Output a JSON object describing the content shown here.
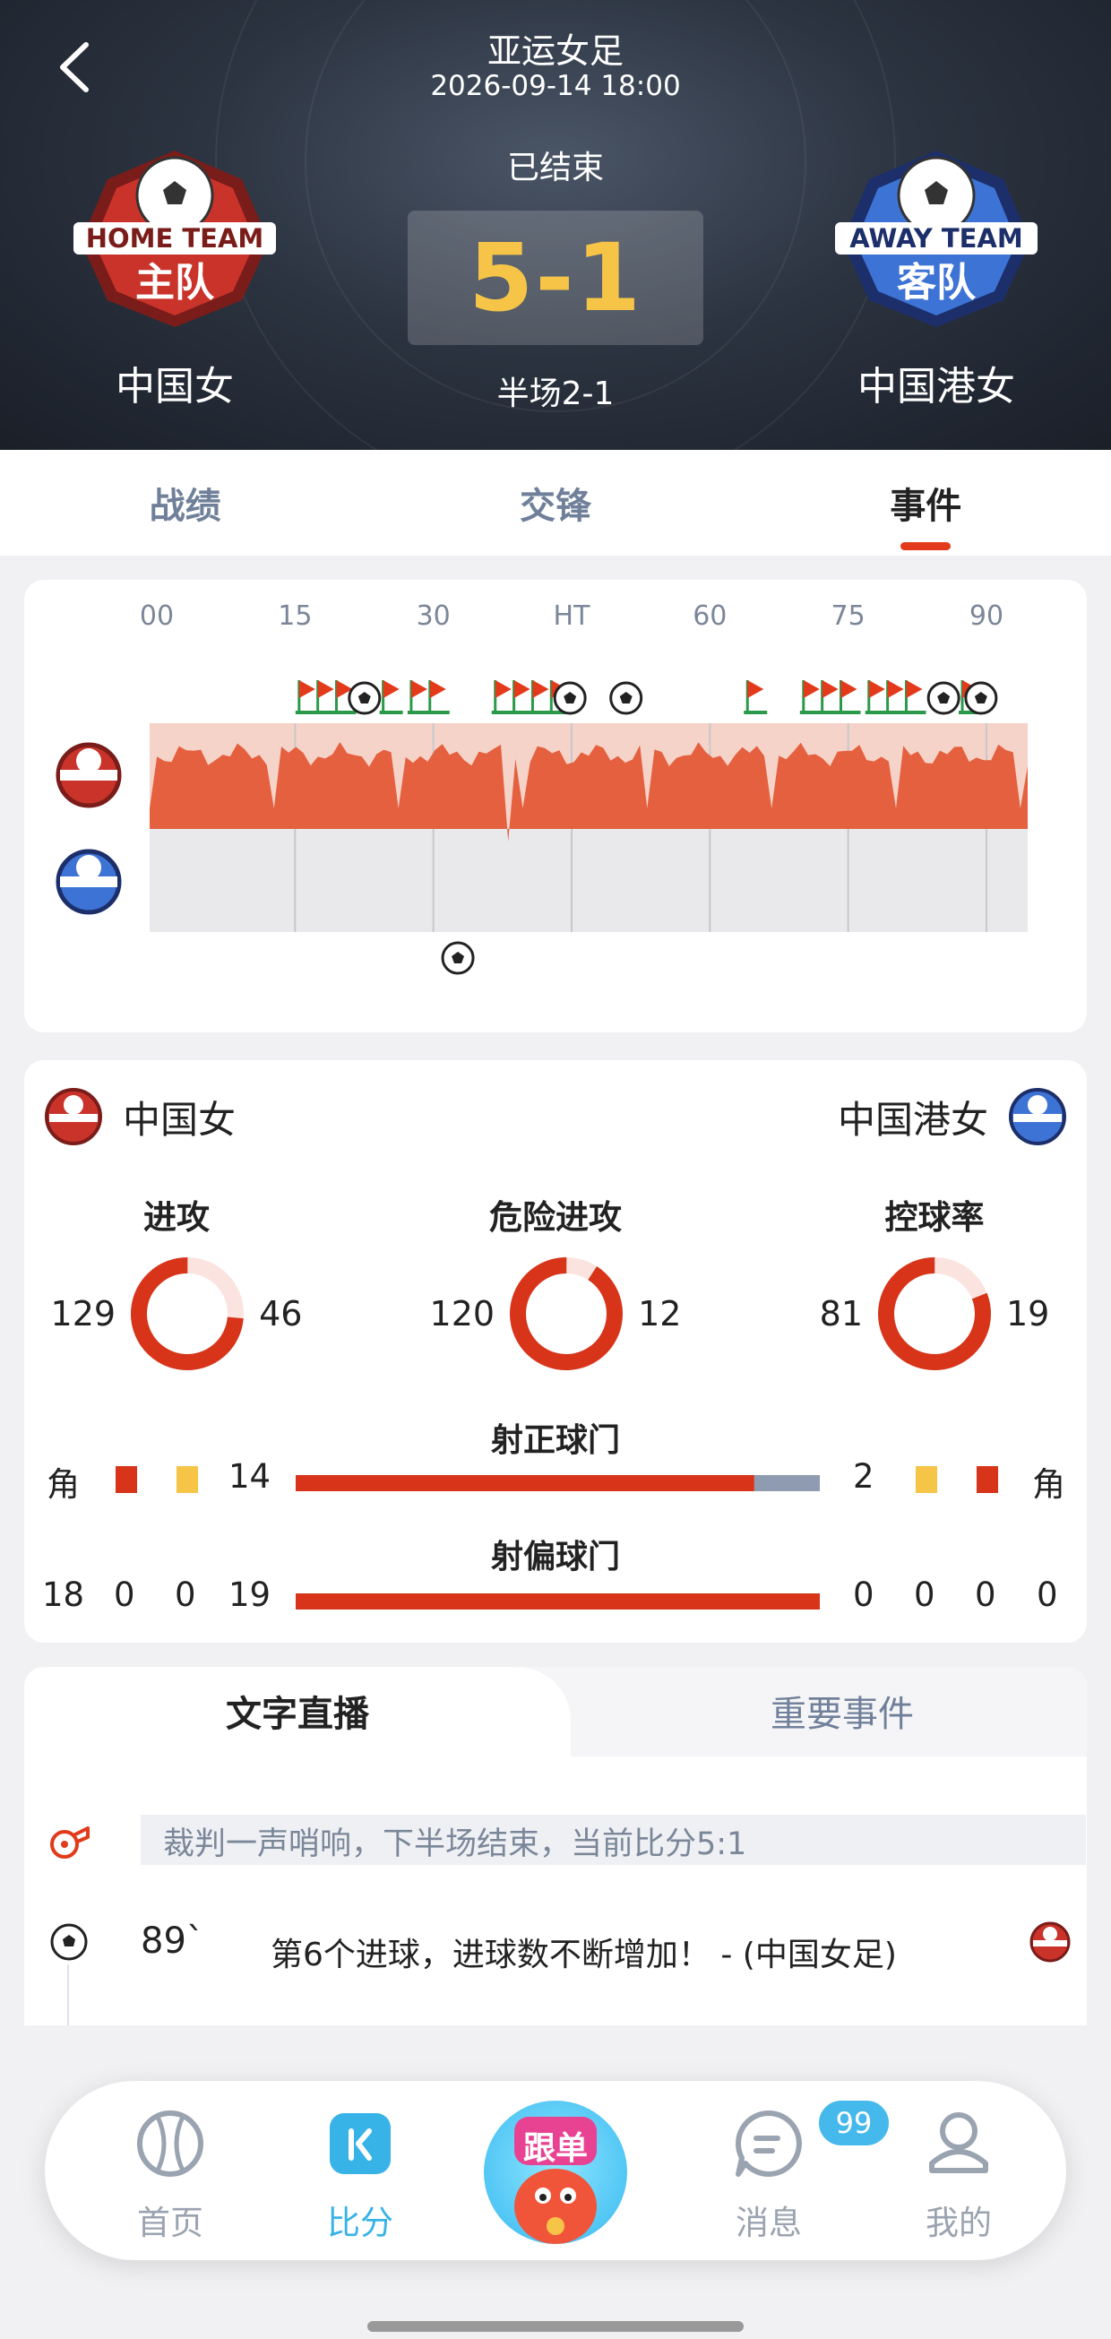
{
  "header": {
    "league": "亚运女足",
    "datetime": "2026-09-14 18:00",
    "status": "已结束",
    "score": "5-1",
    "halftime": "半场2-1",
    "home": {
      "name": "中国女",
      "logo_top": "HOME TEAM",
      "logo_main": "主队",
      "color": "#d93a2b"
    },
    "away": {
      "name": "中国港女",
      "logo_top": "AWAY TEAM",
      "logo_main": "客队",
      "color": "#3a6fd0"
    }
  },
  "tabs": [
    {
      "label": "战绩",
      "active": false
    },
    {
      "label": "交锋",
      "active": false
    },
    {
      "label": "事件",
      "active": true
    }
  ],
  "timeline": {
    "ticks": [
      "00",
      "15",
      "30",
      "HT",
      "60",
      "75",
      "90"
    ],
    "home_goal_minutes": [
      23,
      45,
      51,
      85,
      89
    ],
    "away_goal_minutes": [
      33
    ],
    "home_flag_minutes": [
      16,
      18,
      20,
      25,
      28,
      30,
      37,
      39,
      41,
      43,
      64,
      70,
      72,
      74,
      77,
      79,
      81,
      87
    ]
  },
  "stats": {
    "home_name": "中国女",
    "away_name": "中国港女",
    "attack": {
      "title": "进攻",
      "home": 129,
      "away": 46
    },
    "danger": {
      "title": "危险进攻",
      "home": 120,
      "away": 12
    },
    "possession": {
      "title": "控球率",
      "home": 81,
      "away": 19
    },
    "on_target": {
      "title": "射正球门",
      "home": 14,
      "away": 2,
      "home_corner_label": "角",
      "away_corner_label": "角"
    },
    "off_target": {
      "title": "射偏球门",
      "home": 19,
      "away": 0,
      "home_corners": 18,
      "home_red": 0,
      "home_yellow": 0,
      "away_red": 0,
      "away_yellow": 0,
      "away_corners": 0
    },
    "colors": {
      "home": "#d7341a",
      "away": "#8e9bb0",
      "ring_bg": "#fbe4df",
      "yellow": "#f6c548"
    }
  },
  "live": {
    "tab_text": "文字直播",
    "tab_events": "重要事件",
    "notice": "裁判一声哨响，下半场结束，当前比分5:1",
    "event_minute": "89`",
    "event_text": "第6个进球，进球数不断增加！ - (中国女足)"
  },
  "nav": {
    "home": "首页",
    "score": "比分",
    "center": "跟单",
    "messages": "消息",
    "messages_badge": "99",
    "mine": "我的"
  }
}
